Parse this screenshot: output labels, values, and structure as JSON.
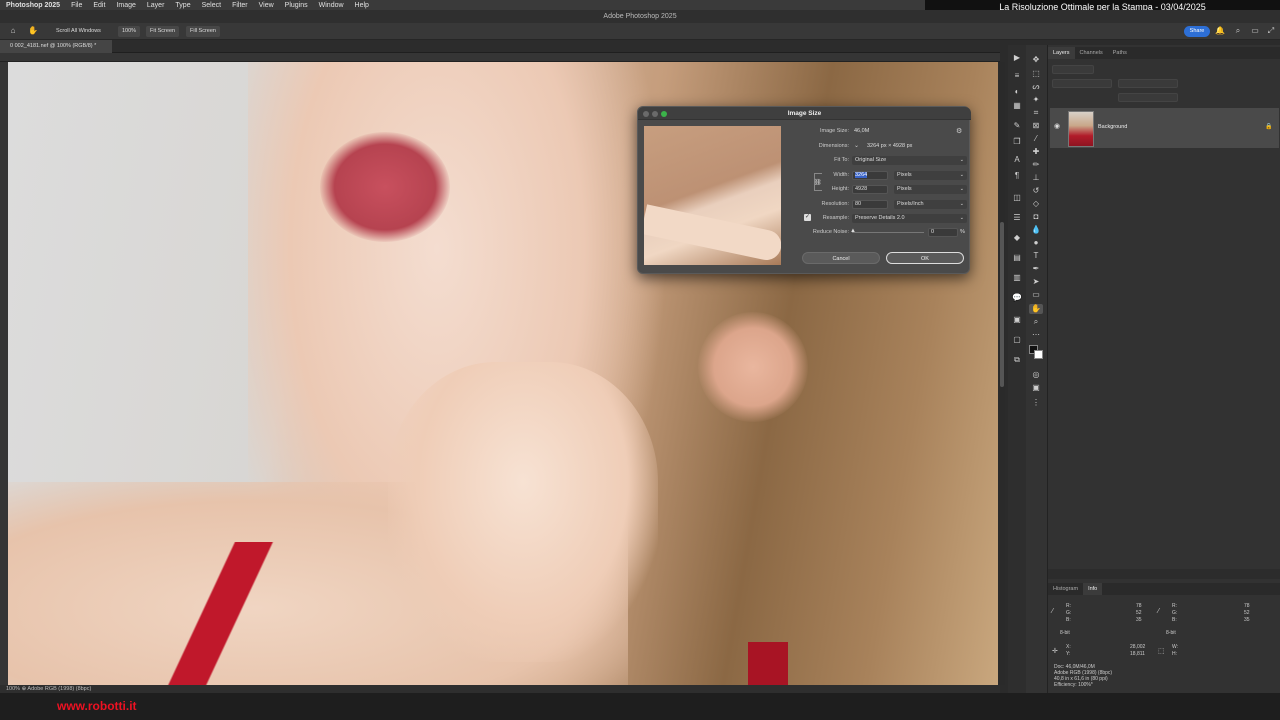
{
  "menubar": {
    "items": [
      "Photoshop 2025",
      "File",
      "Edit",
      "Image",
      "Layer",
      "Type",
      "Select",
      "Filter",
      "View",
      "Plugins",
      "Window",
      "Help"
    ]
  },
  "title_band": "La Risoluzione Ottimale per la Stampa  - 03/04/2025",
  "window_title": "Adobe Photoshop 2025",
  "options": {
    "scroll_all": "Scroll All Windows",
    "zoom": "100%",
    "fit_screen": "Fit Screen",
    "fill_screen": "Fill Screen",
    "share": "Share"
  },
  "document_tab": "0 002_4181.nef @ 100% (RGB/8) *",
  "status": "100%    ⊕ Adobe RGB (1998) (8bpc)",
  "footer_url": "www.robotti.it",
  "dialog": {
    "title": "Image Size",
    "image_size_label": "Image Size:",
    "image_size_value": "46,0M",
    "dimensions_label": "Dimensions:",
    "dimensions_value": "3264 px  ×  4928 px",
    "fit_to_label": "Fit To:",
    "fit_to_value": "Original Size",
    "width_label": "Width:",
    "width_value": "3264",
    "width_unit": "Pixels",
    "height_label": "Height:",
    "height_value": "4928",
    "height_unit": "Pixels",
    "resolution_label": "Resolution:",
    "resolution_value": "80",
    "resolution_unit": "Pixels/Inch",
    "resample_label": "Resample:",
    "resample_value": "Preserve Details 2.0",
    "noise_label": "Reduce Noise:",
    "noise_value": "0",
    "noise_unit": "%",
    "cancel": "Cancel",
    "ok": "OK"
  },
  "layers_panel": {
    "tabs": [
      "Layers",
      "Channels",
      "Paths"
    ],
    "layer_name": "Background"
  },
  "info_panel": {
    "tabs": [
      "Histogram",
      "Info"
    ],
    "r": "R:",
    "g": "G:",
    "b": "B:",
    "rv": "78",
    "gv": "52",
    "bv": "35",
    "rv2": "78",
    "gv2": "52",
    "bv2": "35",
    "bit1": "8-bit",
    "bit2": "8-bit",
    "x_label": "X:",
    "y_label": "Y:",
    "x_value": "28,002",
    "y_value": "18,811",
    "w_label": "W:",
    "h_label": "H:",
    "doc_line1": "Doc: 46,0M/46,0M",
    "doc_line2": "Adobe RGB (1998) (8bpc)",
    "doc_line3": "40,8 in x 61,6 in (80 ppi)",
    "doc_line4": "Efficiency: 100%*"
  },
  "colors": {
    "accent": "#2d6fd6",
    "footer_url": "#e11122"
  }
}
